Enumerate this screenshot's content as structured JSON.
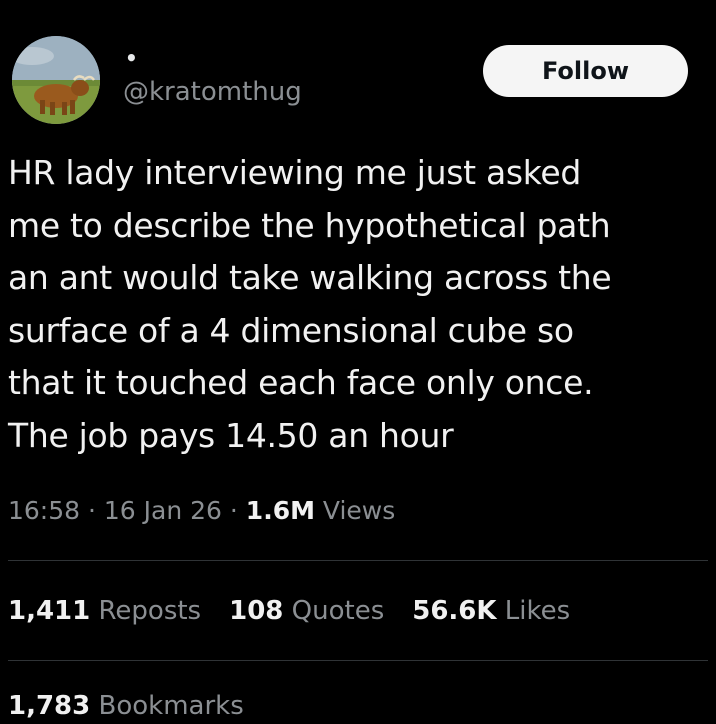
{
  "user": {
    "display_name": "•",
    "handle": "@kratomthug",
    "avatar_icon": "avatar-bull-photo"
  },
  "follow_label": "Follow",
  "tweet": {
    "text": "HR lady interviewing me just asked\nme to describe the hypothetical path\nan ant would take walking across the\nsurface of a 4 dimensional cube so\nthat it touched each face only once.\nThe job pays 14.50 an hour"
  },
  "meta": {
    "time": "16:58",
    "separator": " · ",
    "date": "16 Jan 26",
    "views_count": "1.6M",
    "views_label": " Views"
  },
  "stats": {
    "reposts_count": "1,411",
    "reposts_label": " Reposts",
    "quotes_count": "108",
    "quotes_label": " Quotes",
    "likes_count": "56.6K",
    "likes_label": " Likes",
    "bookmarks_count": "1,783",
    "bookmarks_label": " Bookmarks"
  },
  "colors": {
    "background": "#000000",
    "text": "#f1f1f1",
    "secondary": "#8b8f93",
    "divider": "#2f3336",
    "button_bg": "#f5f5f5"
  }
}
